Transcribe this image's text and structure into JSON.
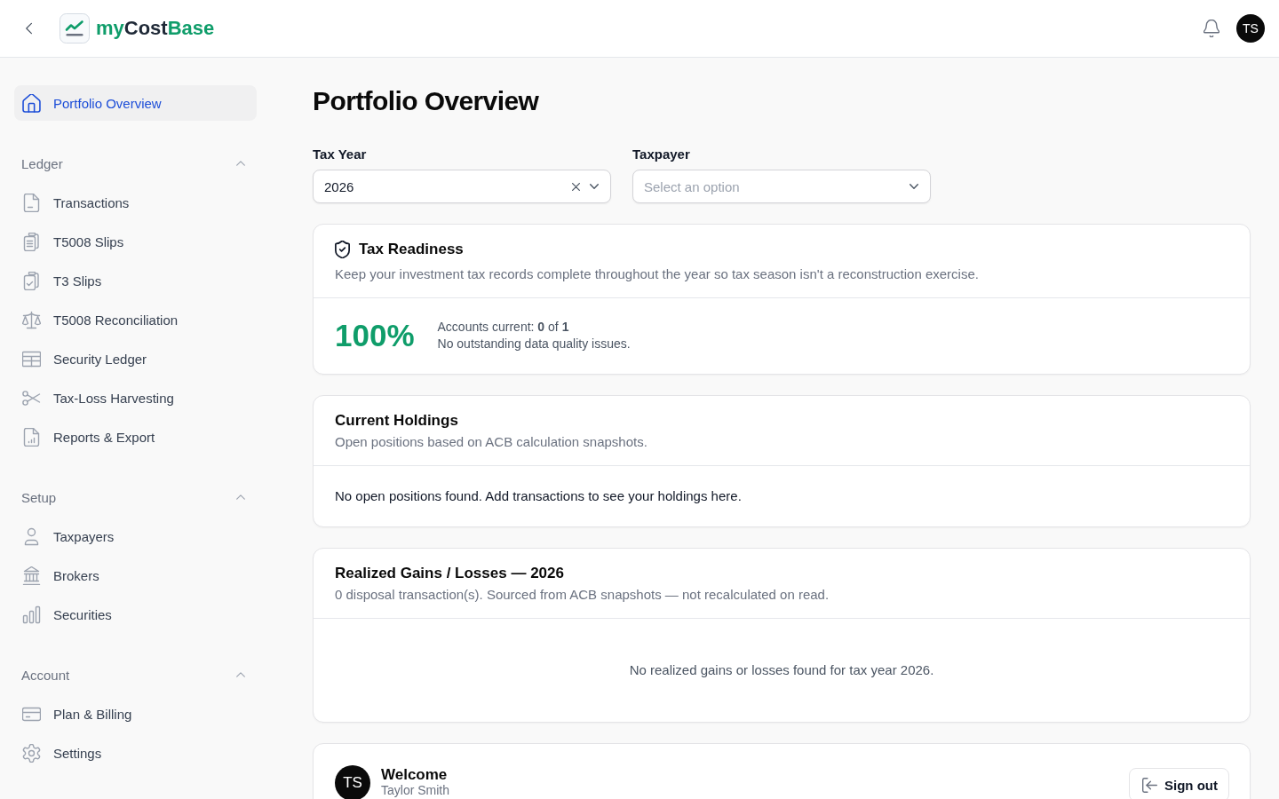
{
  "header": {
    "logo": {
      "parts": [
        {
          "text": "my",
          "kind": "accent"
        },
        {
          "text": "Cost",
          "kind": "plain"
        },
        {
          "text": "Base",
          "kind": "accent"
        }
      ]
    },
    "avatar": {
      "initials": "TS"
    }
  },
  "sidebar": {
    "top_item": {
      "label": "Portfolio Overview",
      "selected": true
    },
    "sections": [
      {
        "title": "Ledger",
        "expanded": true,
        "items": [
          {
            "label": "Transactions",
            "selected": false
          },
          {
            "label": "T5008 Slips",
            "selected": false
          },
          {
            "label": "T3 Slips",
            "selected": false
          },
          {
            "label": "T5008 Reconciliation",
            "selected": false
          },
          {
            "label": "Security Ledger",
            "selected": false
          },
          {
            "label": "Tax-Loss Harvesting",
            "selected": false
          },
          {
            "label": "Reports & Export",
            "selected": false
          }
        ]
      },
      {
        "title": "Setup",
        "expanded": true,
        "items": [
          {
            "label": "Taxpayers",
            "selected": false
          },
          {
            "label": "Brokers",
            "selected": false
          },
          {
            "label": "Securities",
            "selected": false
          }
        ]
      },
      {
        "title": "Account",
        "expanded": true,
        "items": [
          {
            "label": "Plan & Billing",
            "selected": false
          },
          {
            "label": "Settings",
            "selected": false
          }
        ]
      }
    ]
  },
  "page": {
    "title": "Portfolio Overview"
  },
  "filters": [
    {
      "label": "Tax Year",
      "value": "2026"
    },
    {
      "label": "Taxpayer",
      "placeholder": "Select an option"
    }
  ],
  "tax_readiness": {
    "title": "Tax Readiness",
    "description": "Keep your investment tax records complete throughout the year so tax season isn't a reconstruction exercise.",
    "score": "100%",
    "accounts_line": "Accounts current: **0** of **1**",
    "status": "No outstanding data quality issues."
  },
  "holdings": {
    "title": "Current Holdings",
    "description": "Open positions based on ACB calculation snapshots.",
    "empty_message": "No open positions found. Add transactions to see your holdings here."
  },
  "realized": {
    "title": "Realized Gains / Losses — 2026",
    "description": "0 disposal transaction(s). Sourced from ACB snapshots — not recalculated on read.",
    "empty_message": "No realized gains or losses found for tax year 2026."
  },
  "welcome": {
    "avatar_initials": "TS",
    "title": "Welcome",
    "name": "Taylor Smith",
    "sign_out": "Sign out"
  }
}
